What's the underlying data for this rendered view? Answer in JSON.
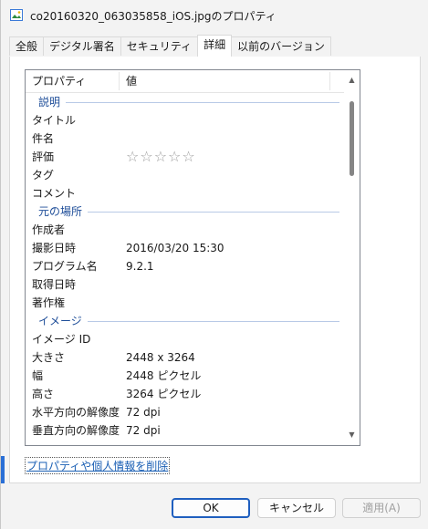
{
  "window": {
    "title": "co20160320_063035858_iOS.jpgのプロパティ"
  },
  "tabs": [
    {
      "label": "全般",
      "active": false
    },
    {
      "label": "デジタル署名",
      "active": false
    },
    {
      "label": "セキュリティ",
      "active": false
    },
    {
      "label": "詳細",
      "active": true
    },
    {
      "label": "以前のバージョン",
      "active": false
    }
  ],
  "list": {
    "header_property": "プロパティ",
    "header_value": "値",
    "rating_stars": "☆☆☆☆☆",
    "sections": [
      {
        "group": "説明",
        "rows": [
          {
            "k": "タイトル",
            "v": ""
          },
          {
            "k": "件名",
            "v": ""
          },
          {
            "k": "評価",
            "v": "",
            "rating": true
          },
          {
            "k": "タグ",
            "v": ""
          },
          {
            "k": "コメント",
            "v": ""
          }
        ]
      },
      {
        "group": "元の場所",
        "rows": [
          {
            "k": "作成者",
            "v": ""
          },
          {
            "k": "撮影日時",
            "v": "2016/03/20 15:30"
          },
          {
            "k": "プログラム名",
            "v": "9.2.1"
          },
          {
            "k": "取得日時",
            "v": ""
          },
          {
            "k": "著作権",
            "v": ""
          }
        ]
      },
      {
        "group": "イメージ",
        "rows": [
          {
            "k": "イメージ ID",
            "v": ""
          },
          {
            "k": "大きさ",
            "v": "2448 x 3264"
          },
          {
            "k": "幅",
            "v": "2448 ピクセル"
          },
          {
            "k": "高さ",
            "v": "3264 ピクセル"
          },
          {
            "k": "水平方向の解像度",
            "v": "72 dpi"
          },
          {
            "k": "垂直方向の解像度",
            "v": "72 dpi"
          }
        ]
      }
    ]
  },
  "remove_link": "プロパティや個人情報を削除",
  "buttons": {
    "ok": "OK",
    "cancel": "キャンセル",
    "apply": "適用(A)"
  },
  "colors": {
    "accent": "#1f5fbf",
    "group_text": "#1f4e99",
    "link": "#1a5fb4"
  }
}
